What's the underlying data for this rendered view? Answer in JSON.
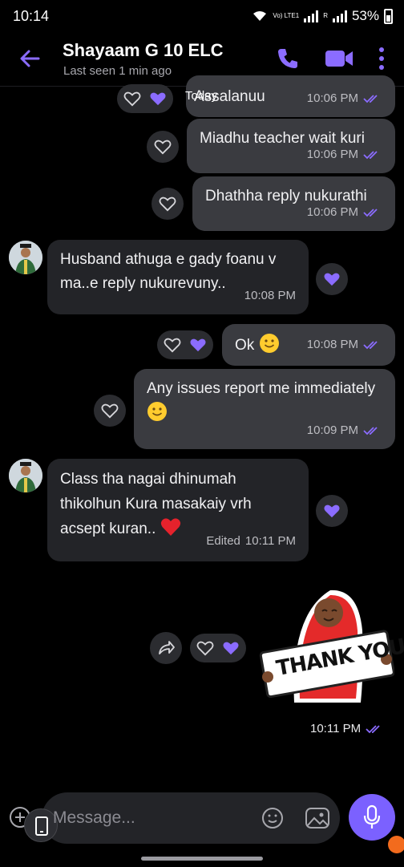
{
  "status_bar": {
    "time": "10:14",
    "network_label": "Vo) LTE1",
    "sim_label": "R",
    "battery": "53%"
  },
  "header": {
    "contact_name": "Shayaam G 10 ELC",
    "last_seen": "Last seen 1 min ago"
  },
  "date_divider": "Today",
  "messages": [
    {
      "direction": "out",
      "text": "Assalanuu",
      "time": "10:06 PM",
      "reactions": [
        "heart-outline",
        "heart-purple"
      ]
    },
    {
      "direction": "out",
      "text": "Miadhu teacher wait kuri",
      "time": "10:06 PM"
    },
    {
      "direction": "out",
      "text": "Dhathha reply nukurathi",
      "time": "10:06 PM"
    },
    {
      "direction": "in",
      "text": "Husband athuga e gady foanu v ma..e reply nukurevuny..",
      "time": "10:08 PM"
    },
    {
      "direction": "out",
      "text": "Ok",
      "emoji": "slightly-smiling-face",
      "time": "10:08 PM"
    },
    {
      "direction": "out",
      "text": "Any issues report me immediately",
      "emoji": "slightly-smiling-face",
      "time": "10:09 PM"
    },
    {
      "direction": "in",
      "text": "Class tha nagai dhinumah thikolhun Kura masakaiy  vrh acsept kuran..",
      "emoji": "red-heart",
      "edited_label": "Edited",
      "time": "10:11 PM"
    },
    {
      "direction": "out",
      "type": "sticker",
      "sticker_text": "THANK YOU!",
      "time": "10:11 PM"
    }
  ],
  "composer": {
    "placeholder": "Message..."
  },
  "colors": {
    "accent": "#7b61ff",
    "outgoing_bubble": "#3a3b40",
    "incoming_bubble": "#232428",
    "background": "#000000"
  }
}
